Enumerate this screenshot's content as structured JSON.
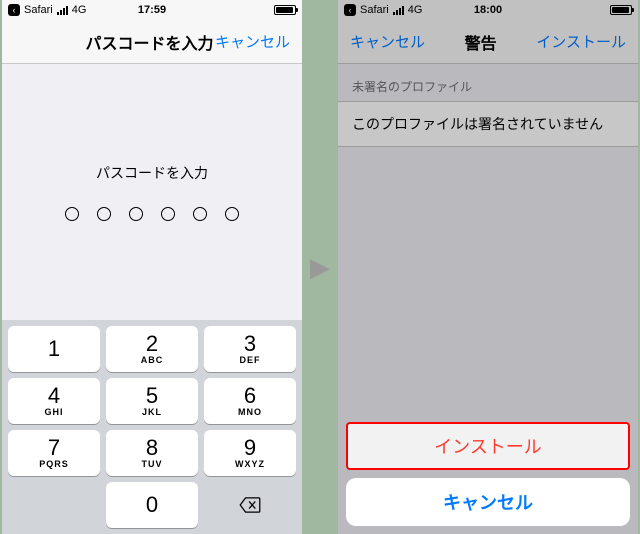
{
  "left": {
    "status": {
      "back_app": "Safari",
      "network": "4G",
      "time": "17:59"
    },
    "nav": {
      "title": "パスコードを入力",
      "cancel": "キャンセル"
    },
    "prompt": "パスコードを入力",
    "keys": [
      {
        "num": "1",
        "sub": ""
      },
      {
        "num": "2",
        "sub": "ABC"
      },
      {
        "num": "3",
        "sub": "DEF"
      },
      {
        "num": "4",
        "sub": "GHI"
      },
      {
        "num": "5",
        "sub": "JKL"
      },
      {
        "num": "6",
        "sub": "MNO"
      },
      {
        "num": "7",
        "sub": "PQRS"
      },
      {
        "num": "8",
        "sub": "TUV"
      },
      {
        "num": "9",
        "sub": "WXYZ"
      },
      {
        "num": "0",
        "sub": ""
      }
    ]
  },
  "right": {
    "status": {
      "back_app": "Safari",
      "network": "4G",
      "time": "18:00"
    },
    "nav": {
      "cancel": "キャンセル",
      "title": "警告",
      "install": "インストール"
    },
    "section_header": "未署名のプロファイル",
    "warning_text": "このプロファイルは署名されていません",
    "sheet": {
      "install": "インストール",
      "cancel": "キャンセル"
    }
  }
}
